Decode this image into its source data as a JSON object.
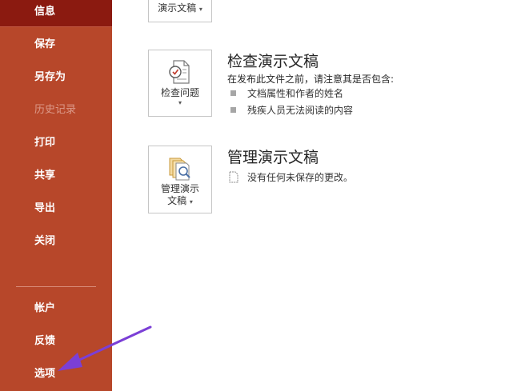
{
  "sidebar": {
    "items": [
      {
        "label": "信息",
        "state": "active"
      },
      {
        "label": "保存",
        "state": "normal"
      },
      {
        "label": "另存为",
        "state": "normal"
      },
      {
        "label": "历史记录",
        "state": "disabled"
      },
      {
        "label": "打印",
        "state": "normal"
      },
      {
        "label": "共享",
        "state": "normal"
      },
      {
        "label": "导出",
        "state": "normal"
      },
      {
        "label": "关闭",
        "state": "normal"
      }
    ],
    "bottom_items": [
      {
        "label": "帐户"
      },
      {
        "label": "反馈"
      },
      {
        "label": "选项"
      }
    ]
  },
  "main": {
    "top_tile_label": "演示文稿",
    "inspect": {
      "tile_label": "检查问题",
      "title": "检查演示文稿",
      "description": "在发布此文件之前，请注意其是否包含:",
      "bullets": [
        "文档属性和作者的姓名",
        "残疾人员无法阅读的内容"
      ]
    },
    "manage": {
      "tile_label_line1": "管理演示",
      "tile_label_line2": "文稿",
      "title": "管理演示文稿",
      "status": "没有任何未保存的更改。"
    }
  },
  "colors": {
    "sidebar_bg": "#b7472a",
    "sidebar_active": "#8b1a10",
    "annotation_arrow": "#7b3fd6"
  }
}
